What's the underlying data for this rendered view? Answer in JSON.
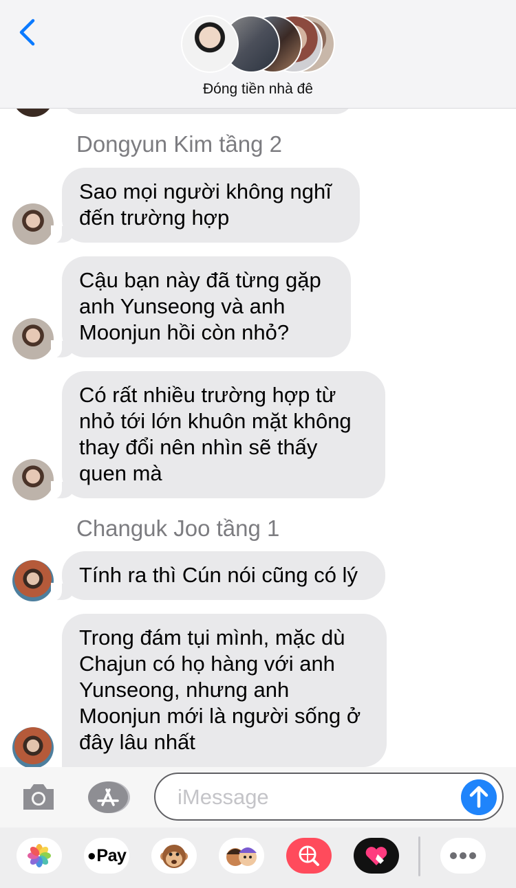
{
  "header": {
    "group_name": "Đóng tiền nhà đê",
    "accent_color": "#0a7aff"
  },
  "messages": [
    {
      "sender": "Dongyun Kim tầng 2"
    },
    {
      "text": "Sao mọi người không nghĩ đến trường hợp"
    },
    {
      "text": "Cậu bạn này đã từng gặp anh Yunseong và anh Moonjun hồi còn nhỏ?"
    },
    {
      "text": "Có rất nhiều trường hợp từ nhỏ tới lớn khuôn mặt không thay đổi nên nhìn sẽ thấy quen mà"
    },
    {
      "sender": "Changuk Joo tầng 1"
    },
    {
      "text": "Tính ra thì Cún nói cũng có lý"
    },
    {
      "text": "Trong đám tụi mình, mặc dù Chajun có họ hàng với anh Yunseong, nhưng anh Moonjun mới là người sống ở đây lâu nhất"
    }
  ],
  "composer": {
    "placeholder": "iMessage",
    "value": ""
  },
  "app_tray": {
    "apple_pay_label": "Pay",
    "items": [
      "photos-app",
      "apple-pay",
      "animoji",
      "memoji",
      "images-search",
      "digital-touch",
      "more"
    ]
  }
}
